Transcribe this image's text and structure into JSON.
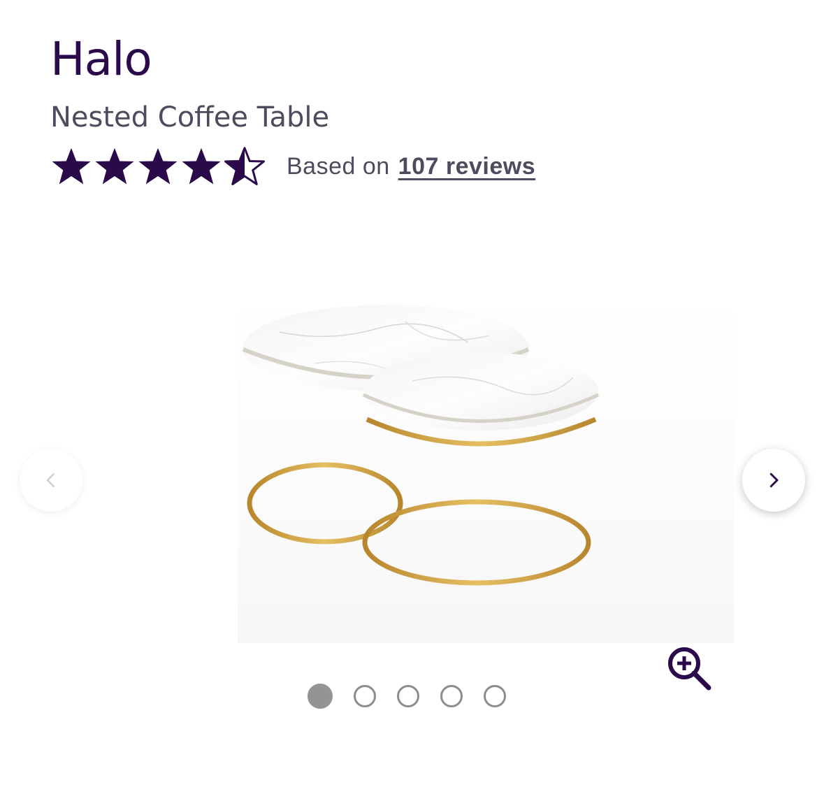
{
  "product": {
    "name": "Halo",
    "subtitle": "Nested Coffee Table"
  },
  "rating": {
    "value": 4.5,
    "max": 5,
    "based_on_prefix": "Based on",
    "reviews_link": "107 reviews"
  },
  "gallery": {
    "image_count": 5,
    "active_index": 0,
    "prev_icon": "chevron-left-icon",
    "next_icon": "chevron-right-icon",
    "zoom_icon": "zoom-in-icon"
  },
  "colors": {
    "brand": "#2a0a4a",
    "text_muted": "#4f4a5e",
    "gold": "#c99a3a",
    "dot_active": "#949494"
  }
}
